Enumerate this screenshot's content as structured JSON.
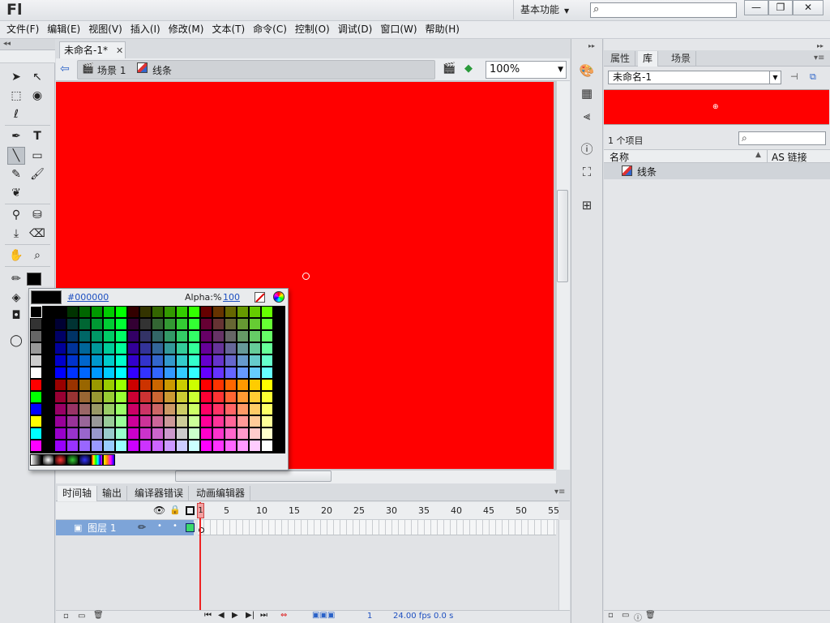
{
  "app": {
    "logo": "Fl",
    "workspace": "基本功能",
    "search_placeholder": "",
    "window_buttons": [
      "minimize",
      "restore",
      "close"
    ]
  },
  "menu": [
    "文件(F)",
    "编辑(E)",
    "视图(V)",
    "插入(I)",
    "修改(M)",
    "文本(T)",
    "命令(C)",
    "控制(O)",
    "调试(D)",
    "窗口(W)",
    "帮助(H)"
  ],
  "document": {
    "tab_title": "未命名-1*",
    "breadcrumb": [
      "场景 1",
      "线条"
    ],
    "zoom": "100%",
    "stage_color": "#ff0000"
  },
  "color_picker": {
    "hex": "#000000",
    "alpha_label": "Alpha:%",
    "alpha_value": "100"
  },
  "timeline": {
    "tabs": [
      "时间轴",
      "输出",
      "编译器错误",
      "动画编辑器"
    ],
    "frame_numbers": [
      "1",
      "5",
      "10",
      "15",
      "20",
      "25",
      "30",
      "35",
      "40",
      "45",
      "50",
      "55"
    ],
    "layer_name": "图层 1",
    "current_frame": "1",
    "fps": "24.00 fps",
    "time": "0.0 s"
  },
  "library": {
    "tabs": [
      "属性",
      "库",
      "场景"
    ],
    "document": "未命名-1",
    "item_count": "1 个项目",
    "columns": [
      "名称",
      "AS 链接"
    ],
    "items": [
      "线条"
    ]
  }
}
